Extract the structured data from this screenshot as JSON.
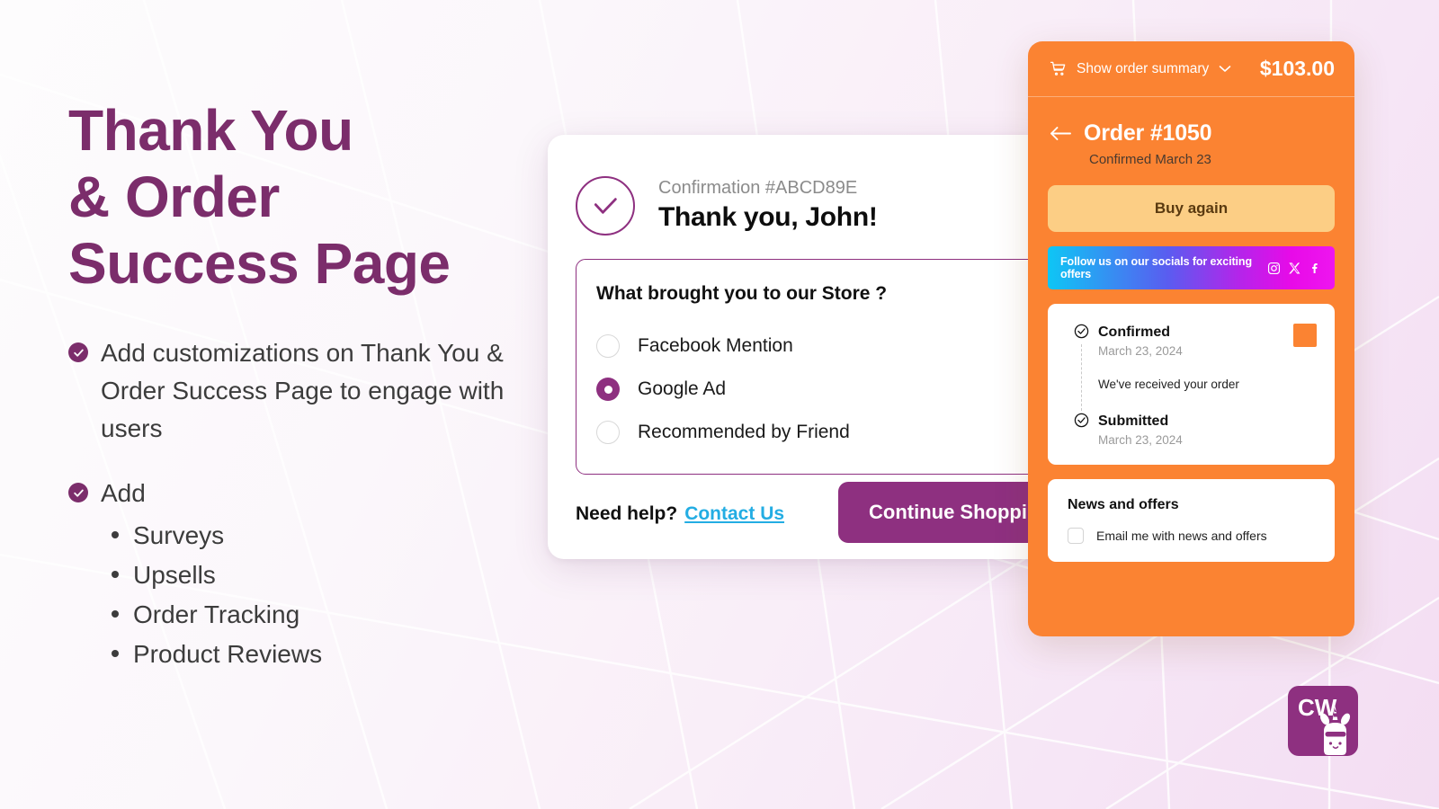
{
  "hero": {
    "title": "Thank You\n& Order\nSuccess Page",
    "bullets": [
      {
        "icon": "check-circle-icon",
        "text": "Add customizations on Thank You & Order Success Page to engage with users"
      },
      {
        "icon": "check-circle-icon",
        "text": "Add"
      }
    ],
    "sub_items": [
      "Surveys",
      "Upsells",
      "Order Tracking",
      "Product Reviews"
    ]
  },
  "card": {
    "icon": "check-circle-outline-icon",
    "confirmation_label": "Confirmation #ABCD89E",
    "thank_you_title": "Thank you, John!",
    "survey": {
      "question": "What brought you to our Store ?",
      "options": [
        {
          "label": "Facebook Mention",
          "selected": false
        },
        {
          "label": "Google Ad",
          "selected": true
        },
        {
          "label": "Recommended by Friend",
          "selected": false
        }
      ]
    },
    "need_help_label": "Need help?",
    "contact_link_label": "Contact Us",
    "continue_button_label": "Continue Shopping"
  },
  "panel": {
    "summary_toggle_label": "Show order summary",
    "cart_icon": "shopping-cart-icon",
    "chevron_icon": "chevron-down-icon",
    "total": "$103.00",
    "back_icon": "arrow-left-icon",
    "order_id": "Order #1050",
    "order_status_date": "Confirmed March 23",
    "buy_again_label": "Buy again",
    "social_banner": {
      "text": "Follow us on our socials for exciting offers",
      "icons": [
        "instagram-icon",
        "x-twitter-icon",
        "facebook-icon"
      ]
    },
    "timeline": [
      {
        "title": "Confirmed",
        "date": "March 23, 2024",
        "icon": "check-circle-icon"
      },
      {
        "title": "Submitted",
        "date": "March 23, 2024",
        "icon": "check-circle-icon"
      }
    ],
    "timeline_message": "We've received your order",
    "news": {
      "title": "News and offers",
      "checkbox_label": "Email me with news and offers",
      "checked": false
    }
  },
  "logo": {
    "initials": "CW",
    "mascot_icon": "unicorn-mascot-icon"
  },
  "colors": {
    "purple": "#7B2D6B",
    "purple_accent": "#8E3080",
    "orange": "#FB8332",
    "orange_light": "#FCCE85",
    "link_blue": "#23ADE3"
  }
}
